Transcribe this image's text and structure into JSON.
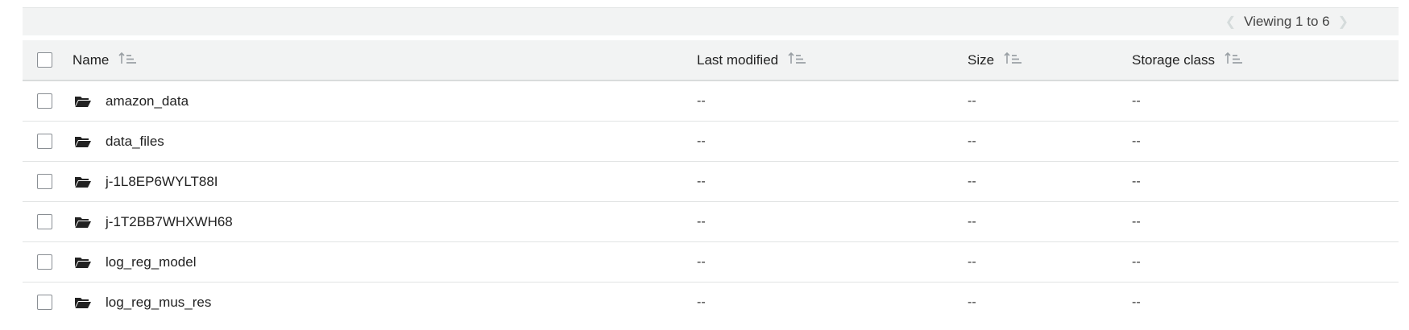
{
  "pager": {
    "prev_icon": "chevron-left-icon",
    "label": "Viewing 1 to 6",
    "next_icon": "chevron-right-icon"
  },
  "table": {
    "columns": [
      {
        "label": "Name",
        "sort_icon": "sort-ascending-icon"
      },
      {
        "label": "Last modified",
        "sort_icon": "sort-ascending-icon"
      },
      {
        "label": "Size",
        "sort_icon": "sort-ascending-icon"
      },
      {
        "label": "Storage class",
        "sort_icon": "sort-ascending-icon"
      }
    ],
    "rows": [
      {
        "icon": "folder-open-icon",
        "name": "amazon_data",
        "last_modified": "--",
        "size": "--",
        "storage_class": "--"
      },
      {
        "icon": "folder-open-icon",
        "name": "data_files",
        "last_modified": "--",
        "size": "--",
        "storage_class": "--"
      },
      {
        "icon": "folder-open-icon",
        "name": "j-1L8EP6WYLT88I",
        "last_modified": "--",
        "size": "--",
        "storage_class": "--"
      },
      {
        "icon": "folder-open-icon",
        "name": "j-1T2BB7WHXWH68",
        "last_modified": "--",
        "size": "--",
        "storage_class": "--"
      },
      {
        "icon": "folder-open-icon",
        "name": "log_reg_model",
        "last_modified": "--",
        "size": "--",
        "storage_class": "--"
      },
      {
        "icon": "folder-open-icon",
        "name": "log_reg_mus_res",
        "last_modified": "--",
        "size": "--",
        "storage_class": "--"
      }
    ]
  },
  "colors": {
    "header_bg": "#f2f3f3",
    "border": "#e1e4e4",
    "checkbox_border": "#8a8f94",
    "icon": "#222222"
  }
}
